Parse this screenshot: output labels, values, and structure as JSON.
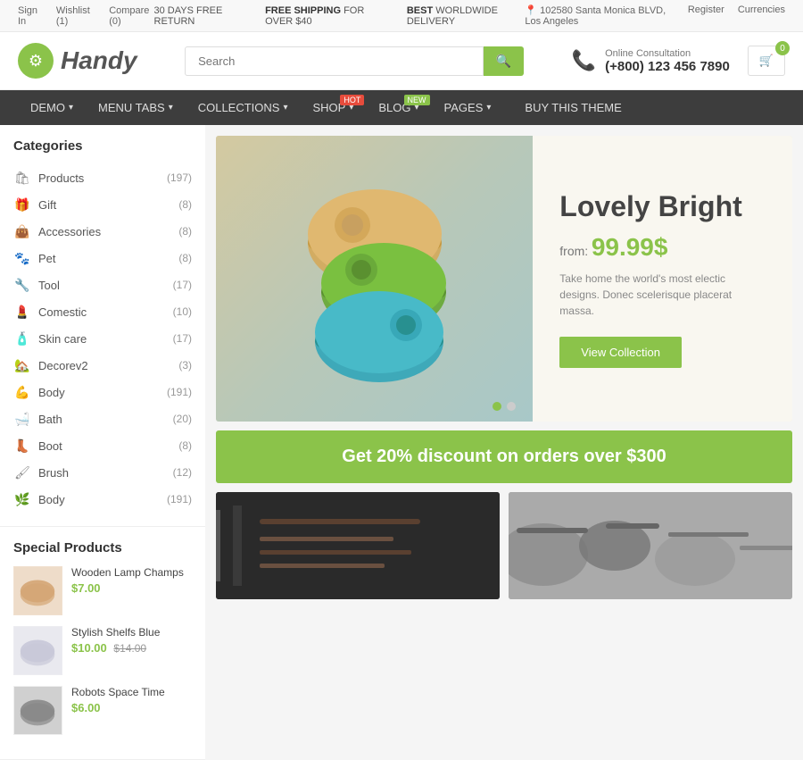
{
  "topbar": {
    "promo1": "30 DAYS FREE RETURN",
    "promo2_prefix": "FREE SHIPPING",
    "promo2_suffix": "FOR OVER $40",
    "promo3_prefix": "BEST",
    "promo3_suffix": "WORLDWIDE DELIVERY",
    "address": "📍 102580 Santa Monica BLVD, Los Angeles",
    "register": "Register",
    "currencies": "Currencies"
  },
  "header": {
    "logo_text": "Handy",
    "search_placeholder": "Search",
    "phone_label": "Online Consultation",
    "phone_number": "(+800) 123 456 7890",
    "cart_count": "0"
  },
  "nav": {
    "items": [
      {
        "label": "DEMO",
        "arrow": true,
        "badge": null
      },
      {
        "label": "MENU TABS",
        "arrow": true,
        "badge": null
      },
      {
        "label": "COLLECTIONS",
        "arrow": true,
        "badge": null
      },
      {
        "label": "SHOP",
        "arrow": true,
        "badge": "HOT"
      },
      {
        "label": "BLOG",
        "arrow": true,
        "badge": "NEW"
      },
      {
        "label": "PAGES",
        "arrow": true,
        "badge": null
      },
      {
        "label": "BUY THIS THEME",
        "arrow": false,
        "badge": null
      }
    ]
  },
  "sidebar": {
    "categories_title": "Categories",
    "categories": [
      {
        "name": "Products",
        "count": 197,
        "icon": "🛍"
      },
      {
        "name": "Gift",
        "count": 8,
        "icon": "🎁"
      },
      {
        "name": "Accessories",
        "count": 8,
        "icon": "👜"
      },
      {
        "name": "Pet",
        "count": 8,
        "icon": "🐾"
      },
      {
        "name": "Tool",
        "count": 17,
        "icon": "🔧"
      },
      {
        "name": "Comestic",
        "count": 10,
        "icon": "💄"
      },
      {
        "name": "Skin care",
        "count": 17,
        "icon": "🧴"
      },
      {
        "name": "Decorev2",
        "count": 3,
        "icon": "🏡"
      },
      {
        "name": "Body",
        "count": 191,
        "icon": "💪"
      },
      {
        "name": "Bath",
        "count": 20,
        "icon": "🛁"
      },
      {
        "name": "Boot",
        "count": 8,
        "icon": "👢"
      },
      {
        "name": "Brush",
        "count": 12,
        "icon": "🖌"
      },
      {
        "name": "Body",
        "count": 191,
        "icon": "🌿"
      }
    ],
    "special_title": "Special Products",
    "special_items": [
      {
        "name": "Wooden Lamp Champs",
        "price": "$7.00",
        "old_price": null,
        "color": "#d4a574"
      },
      {
        "name": "Stylish Shelfs Blue",
        "price": "$10.00",
        "old_price": "$14.00",
        "color": "#c8c8d8"
      },
      {
        "name": "Robots Space Time",
        "price": "$6.00",
        "old_price": null,
        "color": "#888"
      }
    ]
  },
  "hero": {
    "headline": "Lovely Bright",
    "from_label": "from:",
    "price": "99.99$",
    "description": "Take home the world's most electic designs. Donec scelerisque placerat massa.",
    "button_label": "View Collection"
  },
  "promo": {
    "text": "Get 20% discount on orders over $300"
  },
  "accent_color": "#8bc34a",
  "sign_in": "Sign In",
  "wishlist": "Wishlist (1)",
  "compare": "Compare (0)"
}
